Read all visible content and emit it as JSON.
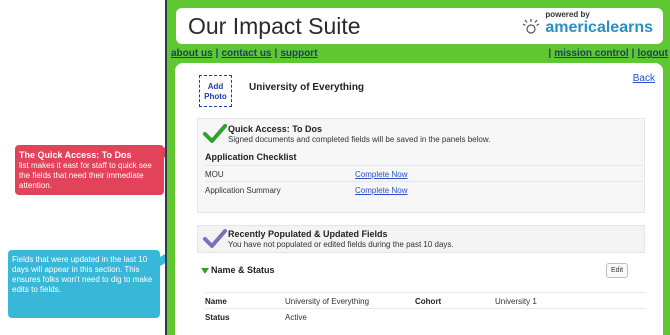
{
  "app": {
    "title": "Our Impact Suite",
    "brand_powered": "powered by",
    "brand_name": "americalearns"
  },
  "nav": {
    "about": "about us",
    "contact": "contact us",
    "support": "support",
    "mission": "mission control",
    "logout": "logout",
    "sep": "|"
  },
  "org": {
    "photo_label": "Add Photo",
    "name": "University of Everything",
    "back": "Back"
  },
  "quick_access": {
    "title": "Quick Access: To Dos",
    "subtitle": "Signed documents and completed fields will be saved in the panels below.",
    "section": "Application Checklist",
    "items": [
      {
        "name": "MOU",
        "action": "Complete Now"
      },
      {
        "name": "Application Summary",
        "action": "Complete Now"
      }
    ]
  },
  "recent": {
    "title": "Recently Populated & Updated Fields",
    "subtitle": "You have not populated or edited fields during the past 10 days."
  },
  "name_status": {
    "label": "Name & Status",
    "edit": "Edit",
    "rows": [
      {
        "k": "Name",
        "v": "University of Everything",
        "k2": "Cohort",
        "v2": "University 1"
      },
      {
        "k": "Status",
        "v": "Active",
        "k2": "",
        "v2": ""
      }
    ]
  },
  "callouts": {
    "c1_bold": "The Quick Access: To Dos",
    "c1_text": "list makes it east for staff to quick see the fields that need their immediate attention.",
    "c2_text": "Fields that were updated in the last 10 days will appear in this section. This ensures folks won't need to dig to make edits to fields."
  },
  "colors": {
    "app_green": "#5ec732",
    "brand_blue": "#2a8fc2",
    "callout_red": "#e2435a",
    "callout_blue": "#38b7d9"
  }
}
